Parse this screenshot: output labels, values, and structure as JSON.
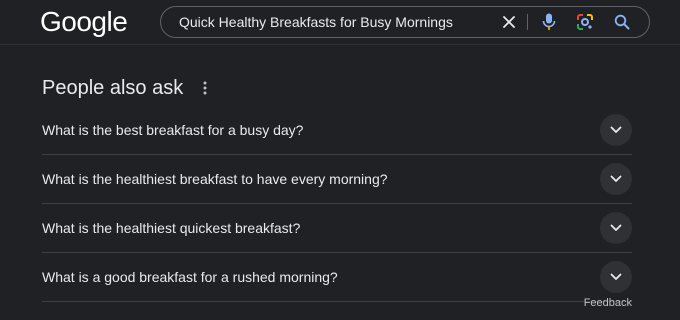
{
  "header": {
    "logo_text": "Google",
    "search": {
      "value": "Quick Healthy Breakfasts for Busy Mornings",
      "icons": [
        "close-icon",
        "microphone-icon",
        "google-lens-icon",
        "search-icon"
      ]
    }
  },
  "people_also_ask": {
    "title": "People also ask",
    "menu_icon": "more-vert-icon",
    "questions": [
      {
        "text": "What is the best breakfast for a busy day?",
        "icon": "chevron-down-icon"
      },
      {
        "text": "What is the healthiest breakfast to have every morning?",
        "icon": "chevron-down-icon"
      },
      {
        "text": "What is the healthiest quickest breakfast?",
        "icon": "chevron-down-icon"
      },
      {
        "text": "What is a good breakfast for a rushed morning?",
        "icon": "chevron-down-icon"
      }
    ]
  },
  "feedback_label": "Feedback",
  "colors": {
    "background": "#202124",
    "text": "#e8eaed",
    "mic_blue": "#8ab4f8",
    "mic_yellow": "#fbbc04",
    "lens_red": "#ea4335",
    "lens_green": "#34a853",
    "lens_yellow": "#fbbc04",
    "search_blue": "#8ab4f8"
  }
}
